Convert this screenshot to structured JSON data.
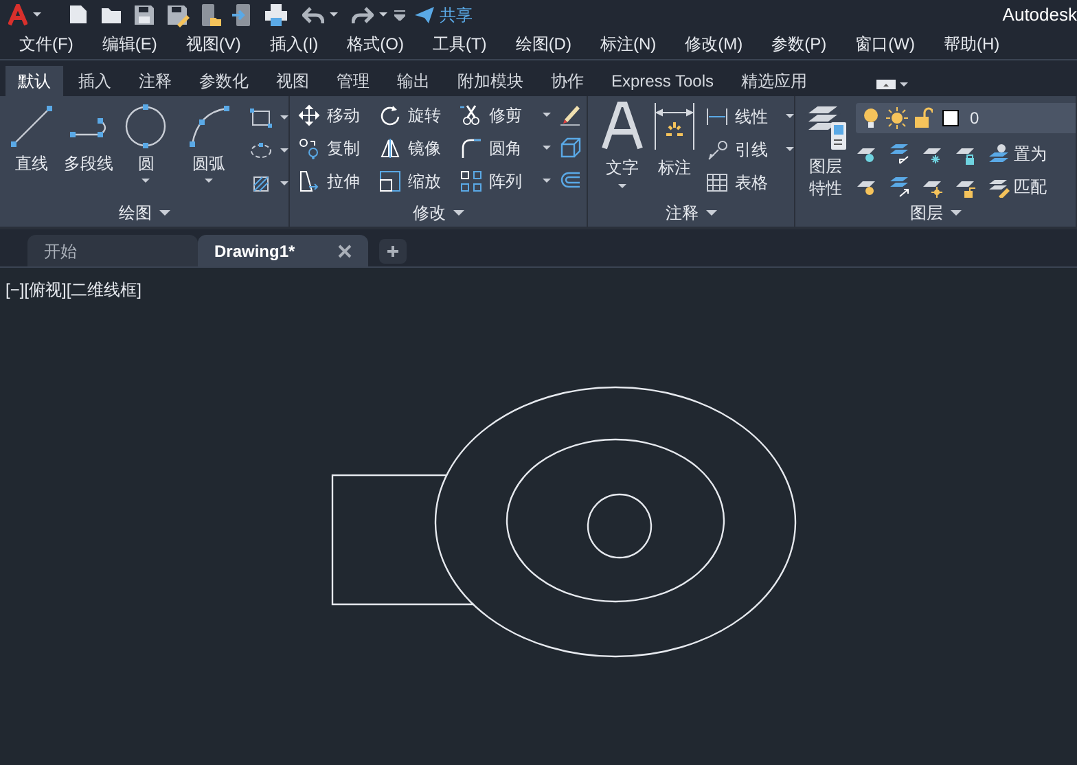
{
  "title_bar": {
    "share": "共享",
    "app_title": "Autodesk"
  },
  "menu_bar": [
    "文件(F)",
    "编辑(E)",
    "视图(V)",
    "插入(I)",
    "格式(O)",
    "工具(T)",
    "绘图(D)",
    "标注(N)",
    "修改(M)",
    "参数(P)",
    "窗口(W)",
    "帮助(H)"
  ],
  "ribbon_tabs": [
    {
      "label": "默认",
      "selected": true
    },
    {
      "label": "插入",
      "selected": false
    },
    {
      "label": "注释",
      "selected": false
    },
    {
      "label": "参数化",
      "selected": false
    },
    {
      "label": "视图",
      "selected": false
    },
    {
      "label": "管理",
      "selected": false
    },
    {
      "label": "输出",
      "selected": false
    },
    {
      "label": "附加模块",
      "selected": false
    },
    {
      "label": "协作",
      "selected": false
    },
    {
      "label": "Express Tools",
      "selected": false
    },
    {
      "label": "精选应用",
      "selected": false
    }
  ],
  "draw_panel": {
    "title": "绘图",
    "tools": [
      {
        "label": "直线",
        "dropdown": false
      },
      {
        "label": "多段线",
        "dropdown": false
      },
      {
        "label": "圆",
        "dropdown": true
      },
      {
        "label": "圆弧",
        "dropdown": true
      }
    ]
  },
  "modify_panel": {
    "title": "修改",
    "tools": [
      {
        "label": "移动",
        "dropdown": false
      },
      {
        "label": "旋转",
        "dropdown": false
      },
      {
        "label": "修剪",
        "dropdown": true
      },
      {
        "label": "复制",
        "dropdown": false
      },
      {
        "label": "镜像",
        "dropdown": false
      },
      {
        "label": "圆角",
        "dropdown": true
      },
      {
        "label": "拉伸",
        "dropdown": false
      },
      {
        "label": "缩放",
        "dropdown": false
      },
      {
        "label": "阵列",
        "dropdown": true
      }
    ]
  },
  "annotation_panel": {
    "title": "注释",
    "large_tools": [
      "文字",
      "标注"
    ],
    "small_tools": [
      {
        "label": "线性",
        "dropdown": true
      },
      {
        "label": "引线",
        "dropdown": true
      },
      {
        "label": "表格",
        "dropdown": false
      }
    ]
  },
  "layer_panel": {
    "title": "图层",
    "properties_button": [
      "图层",
      "特性"
    ],
    "current_layer": "0",
    "tools": [
      "置为",
      "匹配"
    ]
  },
  "file_tabs": [
    {
      "label": "开始",
      "selected": false
    },
    {
      "label": "Drawing1*",
      "selected": true
    }
  ],
  "viewport_label": "[−][俯视][二维线框]"
}
